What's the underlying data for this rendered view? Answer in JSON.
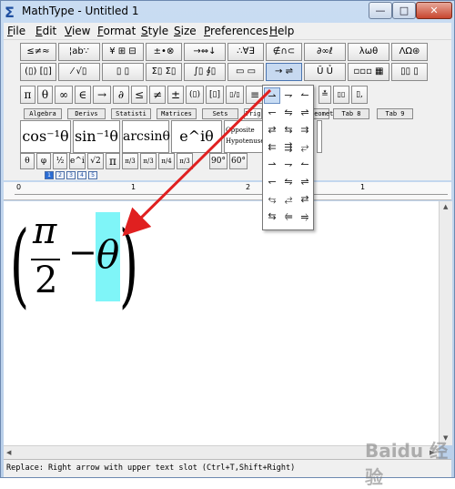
{
  "window": {
    "title": "MathType - Untitled 1",
    "min_label": "—",
    "max_label": "□",
    "close_label": "✕"
  },
  "menu": [
    "File",
    "Edit",
    "View",
    "Format",
    "Style",
    "Size",
    "Preferences",
    "Help"
  ],
  "palettes_row1": [
    "≤≠≈",
    "¦ab∵",
    "¥ ⊞ ⊟",
    "±•⊗",
    "→⇔↓",
    "∴∀∃",
    "∉∩⊂",
    "∂∞ℓ",
    "λωθ",
    "ΛΩ⊛"
  ],
  "palettes_row2": [
    "(▯) [▯]",
    "⁄ √▯",
    "▯ ▯",
    "Σ▯ Σ▯",
    "∫▯ ∮▯",
    "▭ ▭",
    "→ ⇌",
    "Ū Ủ",
    "▫▫▫ ▦",
    "▯▯ ▯"
  ],
  "symbols_row": [
    "π",
    "θ",
    "∞",
    "∈",
    "→",
    "∂",
    "≤",
    "≠",
    "±",
    "(▯)",
    "[▯]",
    "▯/▯",
    "≡",
    "≛",
    "▯▯",
    "▯,",
    "▯̇"
  ],
  "tabs": [
    "Algebra",
    "Derivs",
    "Statisti",
    "Matrices",
    "Sets",
    "Trig",
    "Geometry",
    "Tab 8",
    "Tab 9"
  ],
  "big_templates": [
    "cos⁻¹θ",
    "sin⁻¹θ",
    "arcsinθ",
    "e^iθ"
  ],
  "big_text_lines": [
    "Opposite",
    "Hypotenuse"
  ],
  "small_templates": [
    "θ",
    "φ",
    "½",
    "e^iθ",
    "√2",
    "π",
    "π/3",
    "π/3",
    "π/4",
    "π/3",
    "90°",
    "60°"
  ],
  "tab_sizes": [
    "1",
    "2",
    "3",
    "4",
    "5"
  ],
  "ruler_numbers": [
    "0",
    "1",
    "2",
    "1"
  ],
  "equation": {
    "numerator": "π",
    "denominator": "2",
    "operator": "−",
    "variable": "θ",
    "left_paren": "(",
    "right_paren": ")"
  },
  "popup_cells": [
    "⇀",
    "⇁",
    "↼",
    "↽",
    "⇋",
    "⇌",
    "⇄",
    "⇆",
    "⇉",
    "⇇",
    "⇶",
    "⥂",
    "⇀",
    "⇁",
    "↼",
    "↽",
    "⇋",
    "⇌",
    "⥃",
    "⥄",
    "⇄",
    "⇆",
    "⥢",
    "⥤",
    "↜",
    "↝",
    "⇜",
    "⇝"
  ],
  "status": "Replace: Right arrow with upper text slot (Ctrl+T,Shift+Right)",
  "watermark": "Baidu 经验",
  "colors": {
    "selection": "#7ff5f8",
    "annotation_arrow": "#e02020",
    "title_gradient": "#c9dcf2"
  }
}
